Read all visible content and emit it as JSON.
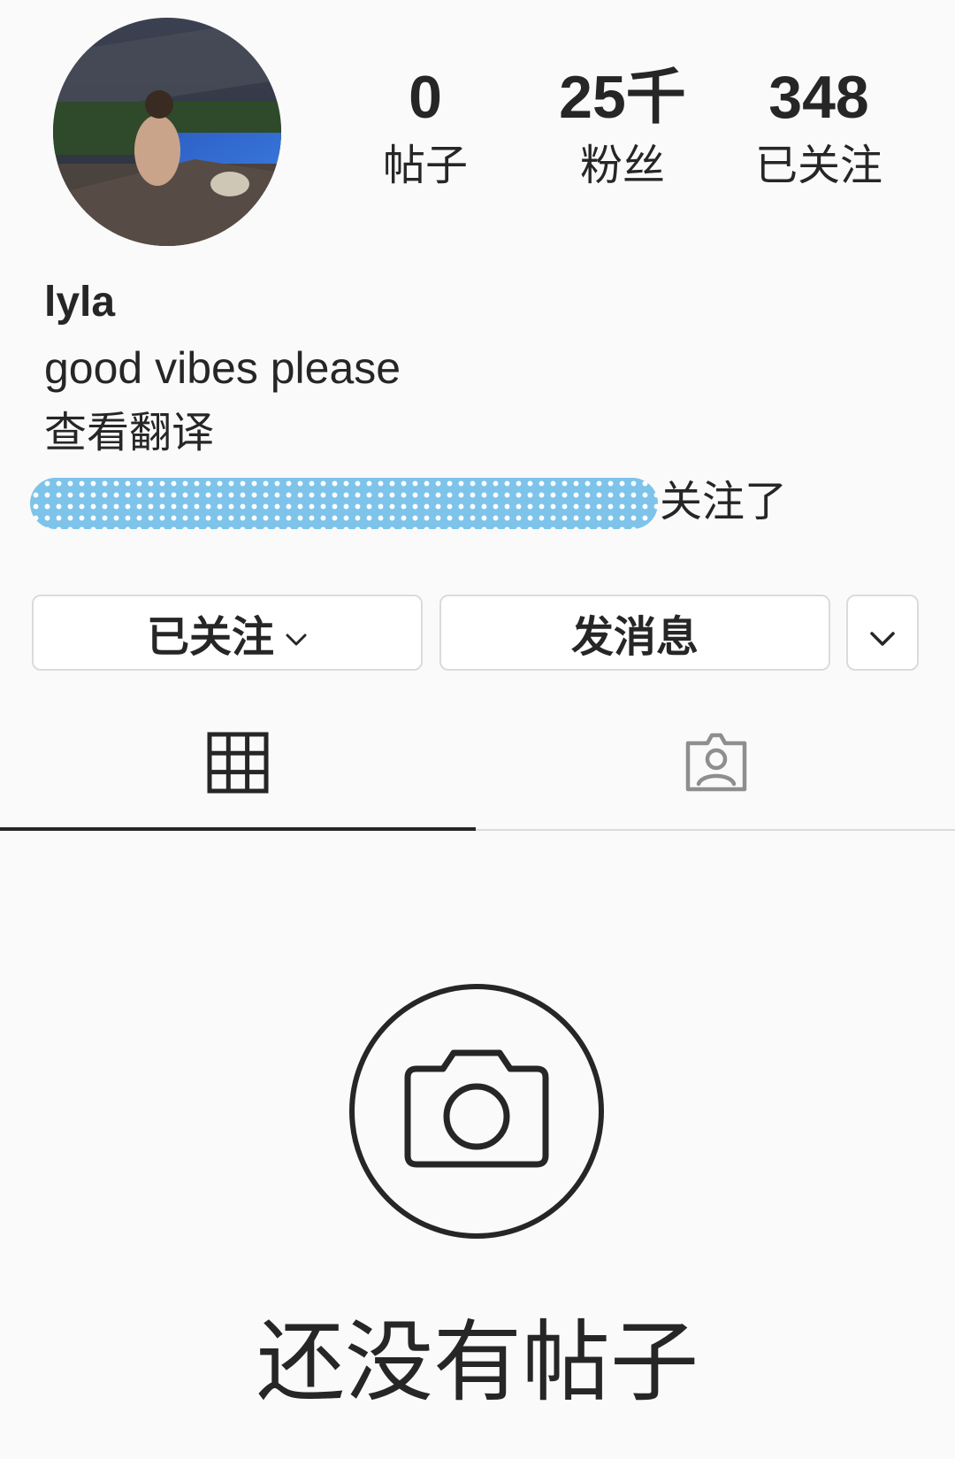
{
  "profile": {
    "username": "lyla",
    "bio": "good vibes please",
    "translate_label": "查看翻译",
    "followed_by_suffix": "关注了"
  },
  "stats": [
    {
      "value": "0",
      "label": "帖子"
    },
    {
      "value": "25千",
      "label": "粉丝"
    },
    {
      "value": "348",
      "label": "已关注"
    }
  ],
  "actions": {
    "following_label": "已关注",
    "message_label": "发消息",
    "more_icon": "chevron-down-icon"
  },
  "tabs": {
    "grid_icon": "grid-icon",
    "tagged_icon": "tagged-icon",
    "active": "grid"
  },
  "empty_state": {
    "icon": "camera-icon",
    "title": "还没有帖子"
  },
  "colors": {
    "text": "#262626",
    "border": "#dbdbdb",
    "redaction": "#7ec3ea",
    "background": "#fafafa"
  }
}
